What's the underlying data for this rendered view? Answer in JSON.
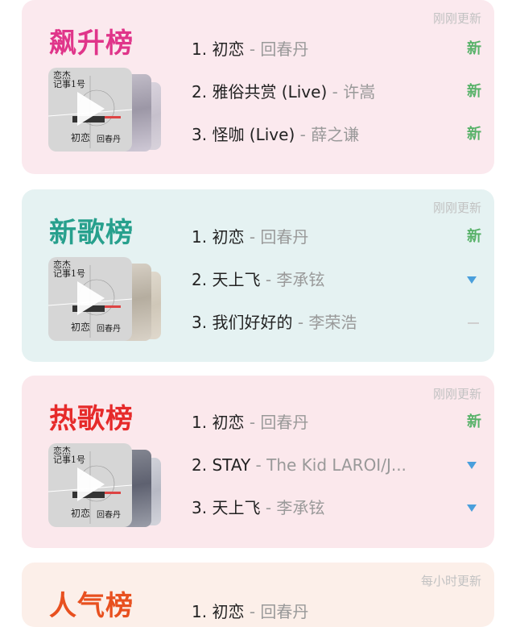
{
  "charts": [
    {
      "title": "飙升榜",
      "update": "刚刚更新",
      "rows": [
        {
          "num": "1.",
          "song": "初恋",
          "artist": "回春丹",
          "status": "new",
          "status_text": "新"
        },
        {
          "num": "2.",
          "song": "雅俗共赏 (Live)",
          "artist": "许嵩",
          "status": "new",
          "status_text": "新"
        },
        {
          "num": "3.",
          "song": "怪咖 (Live)",
          "artist": "薛之谦",
          "status": "new",
          "status_text": "新"
        }
      ]
    },
    {
      "title": "新歌榜",
      "update": "刚刚更新",
      "rows": [
        {
          "num": "1.",
          "song": "初恋",
          "artist": "回春丹",
          "status": "new",
          "status_text": "新"
        },
        {
          "num": "2.",
          "song": "天上飞",
          "artist": "李承铉",
          "status": "down",
          "status_text": ""
        },
        {
          "num": "3.",
          "song": "我们好好的",
          "artist": "李荣浩",
          "status": "same",
          "status_text": ""
        }
      ]
    },
    {
      "title": "热歌榜",
      "update": "刚刚更新",
      "rows": [
        {
          "num": "1.",
          "song": "初恋",
          "artist": "回春丹",
          "status": "new",
          "status_text": "新"
        },
        {
          "num": "2.",
          "song": "STAY",
          "artist": "The Kid LAROI/J...",
          "status": "down",
          "status_text": ""
        },
        {
          "num": "3.",
          "song": "天上飞",
          "artist": "李承铉",
          "status": "down",
          "status_text": ""
        }
      ]
    },
    {
      "title": "人气榜",
      "update": "每小时更新",
      "rows": [
        {
          "num": "1.",
          "song": "初恋",
          "artist": "回春丹",
          "status": "",
          "status_text": ""
        }
      ]
    }
  ],
  "separator": "-",
  "cover": {
    "line1": "恋杰",
    "line2": "记事1号",
    "line3": "初恋",
    "line4": "回春丹"
  },
  "colors": {
    "new_badge": "#59b26a",
    "down_arrow": "#4a9fdc",
    "title_1": "#e0358a",
    "title_2": "#27a08d",
    "title_3": "#e62a2a",
    "title_4": "#e8501f"
  }
}
